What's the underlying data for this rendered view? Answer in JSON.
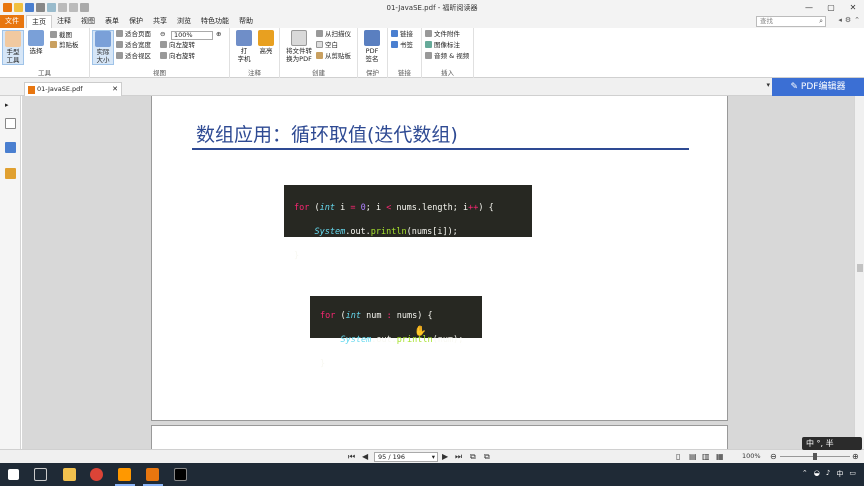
{
  "window": {
    "title": "01-JavaSE.pdf - 福昕阅读器"
  },
  "menu": {
    "items": [
      "文件",
      "主页",
      "注释",
      "视图",
      "表单",
      "保护",
      "共享",
      "浏览",
      "特色功能",
      "帮助"
    ],
    "active": "主页"
  },
  "search": {
    "placeholder": "查找"
  },
  "ribbon": {
    "tools_group": {
      "label": "工具",
      "hand": "手型\n工具",
      "select": "选择",
      "screenshot": "截图",
      "clipboard": "剪贴板"
    },
    "view_group": {
      "label": "视图",
      "actual_size": "实际\n大小",
      "fit_page": "适合页面",
      "fit_width": "适合宽度",
      "fit_visible": "适合视区",
      "zoom": "100%",
      "rotate_left": "向左旋转",
      "rotate_right": "向右旋转"
    },
    "comment_group": {
      "label": "注释",
      "typewriter": "打\n字机",
      "highlight": "高亮"
    },
    "create_group": {
      "label": "创建",
      "convert": "将文件转\n换为PDF",
      "from_scanner": "从扫描仪",
      "blank": "空白",
      "from_clipboard": "从剪贴板"
    },
    "protect_group": {
      "label": "保护",
      "sign": "PDF\n签名"
    },
    "link_group": {
      "label": "链接",
      "link": "链接",
      "bookmark": "书签"
    },
    "insert_group": {
      "label": "插入",
      "attachment": "文件附件",
      "image": "图像标注",
      "audio_video": "音频 & 视频"
    }
  },
  "tabs": {
    "doc": "01-JavaSE.pdf",
    "pdf_editor": "PDF编辑器"
  },
  "document": {
    "title": "数组应用：循环取值(迭代数组)",
    "code1": {
      "line1_kw": "for",
      "line1_a": " (",
      "line1_type": "int",
      "line1_b": " i ",
      "line1_eq": "=",
      "line1_sp": " ",
      "line1_zero": "0",
      "line1_c": "; i ",
      "line1_lt": "<",
      "line1_d": " nums.length; i",
      "line1_pp": "++",
      "line1_e": ") {",
      "line2_pre": "    ",
      "line2_cls": "System",
      "line2_a": ".out.",
      "line2_fn": "println",
      "line2_b": "(nums[i]);",
      "line3": "}"
    },
    "code2": {
      "line1_kw": "for",
      "line1_a": " (",
      "line1_type": "int",
      "line1_b": " num ",
      "line1_colon": ":",
      "line1_c": " nums) {",
      "line2_pre": "    ",
      "line2_cls": "System",
      "line2_a": ".out.",
      "line2_fn": "println",
      "line2_b": "(num);",
      "line3": "}"
    }
  },
  "status": {
    "page": "95 / 196",
    "zoom": "100%"
  },
  "ime": {
    "text": "中 °, 半"
  },
  "taskbar": {
    "tray_time": "中"
  },
  "colors": {
    "accent": "#e8760f",
    "title_blue": "#2e4a93",
    "editor_blue": "#3b6fd4",
    "code_bg": "#272822"
  }
}
